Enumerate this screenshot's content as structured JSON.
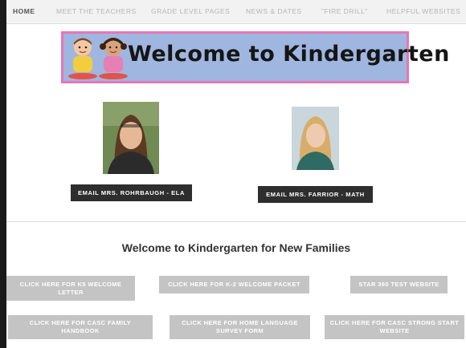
{
  "nav": {
    "items": [
      {
        "label": "HOME",
        "active": true
      },
      {
        "label": "MEET THE TEACHERS",
        "active": false
      },
      {
        "label": "GRADE LEVEL PAGES",
        "active": false
      },
      {
        "label": "NEWS & DATES",
        "active": false
      },
      {
        "label": "\"FIRE DRILL\"",
        "active": false
      },
      {
        "label": "HELPFUL WEBSITES",
        "active": false
      }
    ]
  },
  "banner": {
    "title": "Welcome to Kindergarten"
  },
  "teachers": {
    "rohrbaugh_button": "EMAIL MRS. ROHRBAUGH - ELA",
    "farrior_button": "EMAIL MRS. FARRIOR - MATH"
  },
  "families": {
    "title": "Welcome to Kindergarten for New Families",
    "buttons": [
      "CLICK HERE FOR K5 WELCOME LETTER",
      "CLICK HERE FOR K-2 WELCOME PACKET",
      "STAR 360 TEST WEBSITE",
      "CLICK HERE FOR CASC FAMILY HANDBOOK",
      "CLICK HERE FOR HOME LANGUAGE SURVEY FORM",
      "CLICK HERE FOR CASC STRONG START WEBSITE"
    ]
  },
  "colors": {
    "banner_bg": "#9fb6e0",
    "banner_border": "#e776b6",
    "dark_button": "#2e2e2e",
    "gray_button": "#c4c4c4"
  }
}
